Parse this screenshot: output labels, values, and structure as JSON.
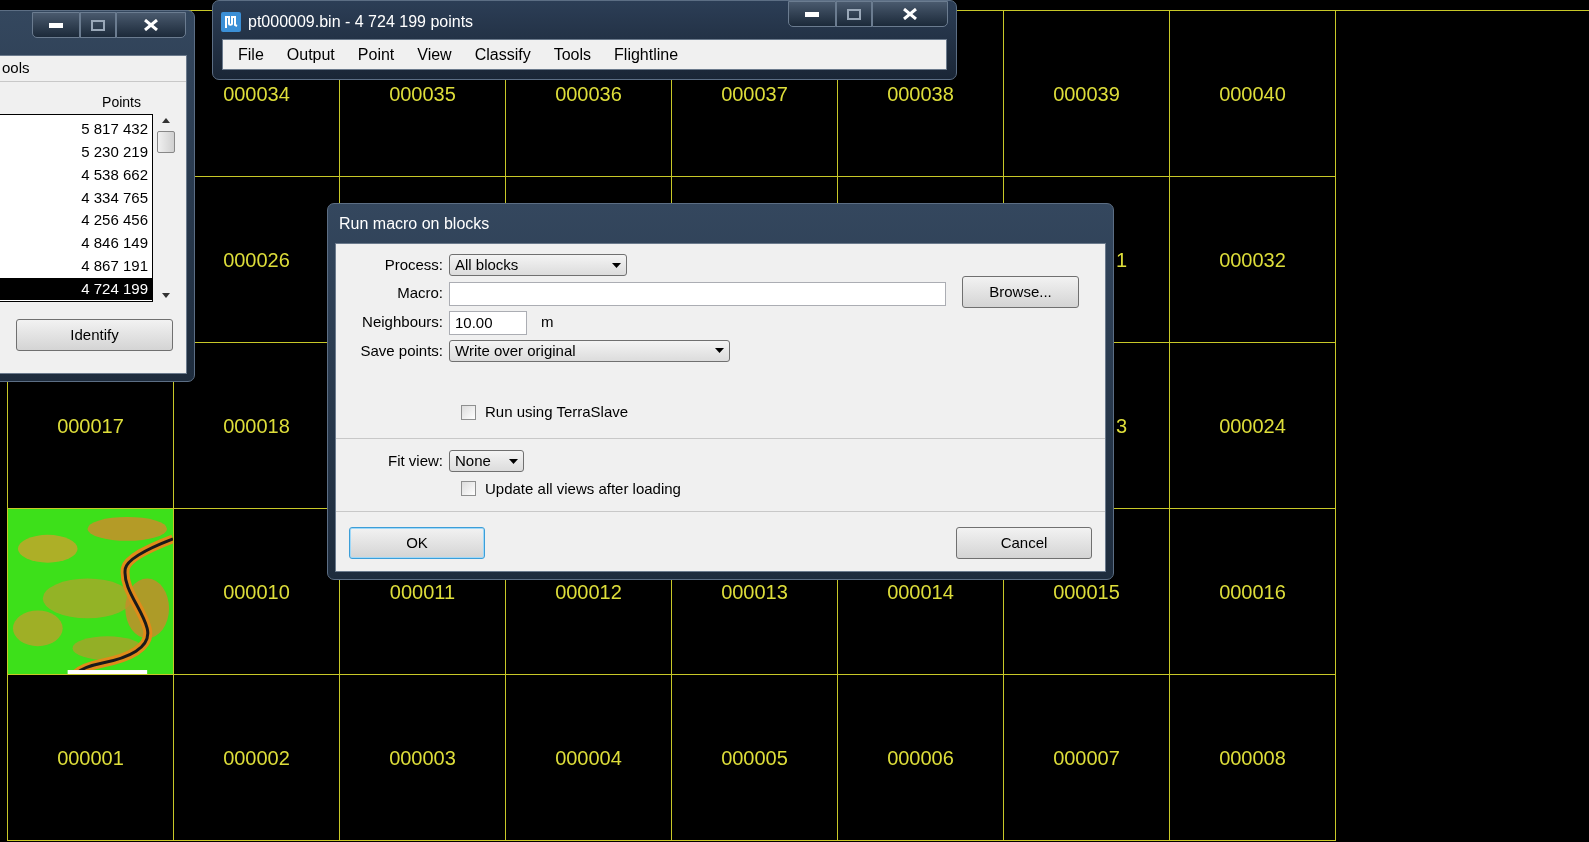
{
  "tile_rows": [
    [
      {
        "kind": "blank"
      },
      {
        "kind": "label",
        "label": "000034"
      },
      {
        "kind": "label",
        "label": "000035"
      },
      {
        "kind": "label",
        "label": "000036"
      },
      {
        "kind": "label",
        "label": "000037"
      },
      {
        "kind": "label",
        "label": "000038"
      },
      {
        "kind": "label",
        "label": "000039"
      },
      {
        "kind": "label",
        "label": "000040"
      }
    ],
    [
      {
        "kind": "blank"
      },
      {
        "kind": "label",
        "label": "000026"
      },
      {
        "kind": "blank"
      },
      {
        "kind": "blank"
      },
      {
        "kind": "blank"
      },
      {
        "kind": "blank"
      },
      {
        "kind": "cut",
        "label": "1"
      },
      {
        "kind": "label",
        "label": "000032"
      }
    ],
    [
      {
        "kind": "label",
        "label": "000017"
      },
      {
        "kind": "label",
        "label": "000018"
      },
      {
        "kind": "blank"
      },
      {
        "kind": "blank"
      },
      {
        "kind": "blank"
      },
      {
        "kind": "blank"
      },
      {
        "kind": "cut",
        "label": "3"
      },
      {
        "kind": "label",
        "label": "000024"
      }
    ],
    [
      {
        "kind": "picture"
      },
      {
        "kind": "label",
        "label": "000010"
      },
      {
        "kind": "label",
        "label": "000011"
      },
      {
        "kind": "label",
        "label": "000012"
      },
      {
        "kind": "label",
        "label": "000013"
      },
      {
        "kind": "label",
        "label": "000014"
      },
      {
        "kind": "label",
        "label": "000015"
      },
      {
        "kind": "label",
        "label": "000016"
      }
    ],
    [
      {
        "kind": "label",
        "label": "000001"
      },
      {
        "kind": "label",
        "label": "000002"
      },
      {
        "kind": "label",
        "label": "000003"
      },
      {
        "kind": "label",
        "label": "000004"
      },
      {
        "kind": "label",
        "label": "000005"
      },
      {
        "kind": "label",
        "label": "000006"
      },
      {
        "kind": "label",
        "label": "000007"
      },
      {
        "kind": "label",
        "label": "000008"
      }
    ]
  ],
  "block_window": {
    "menu_fragment": "ools",
    "column_header": "Points",
    "rows": [
      {
        "points": "5 817 432",
        "selected": false
      },
      {
        "points": "5 230 219",
        "selected": false
      },
      {
        "points": "4 538 662",
        "selected": false
      },
      {
        "points": "4 334 765",
        "selected": false
      },
      {
        "points": "4 256 456",
        "selected": false
      },
      {
        "points": "4 846 149",
        "selected": false
      },
      {
        "points": "4 867 191",
        "selected": false
      },
      {
        "points": "4 724 199",
        "selected": true
      }
    ],
    "button": "Identify"
  },
  "main_window": {
    "title": "pt000009.bin - 4 724 199 points",
    "menu": [
      "File",
      "Output",
      "Point",
      "View",
      "Classify",
      "Tools",
      "Flightline"
    ]
  },
  "dialog": {
    "title": "Run macro on blocks",
    "process": {
      "label": "Process:",
      "value": "All blocks"
    },
    "macro": {
      "label": "Macro:"
    },
    "browse": "Browse...",
    "neighbours": {
      "label": "Neighbours:",
      "value": "10.00",
      "unit": "m"
    },
    "save_points": {
      "label": "Save points:",
      "value": "Write over original"
    },
    "terraslave": {
      "label": "Run using TerraSlave",
      "checked": false
    },
    "fit_view": {
      "label": "Fit view:",
      "value": "None"
    },
    "update_views": {
      "label": "Update all views after loading",
      "checked": false
    },
    "ok": "OK",
    "cancel": "Cancel"
  }
}
